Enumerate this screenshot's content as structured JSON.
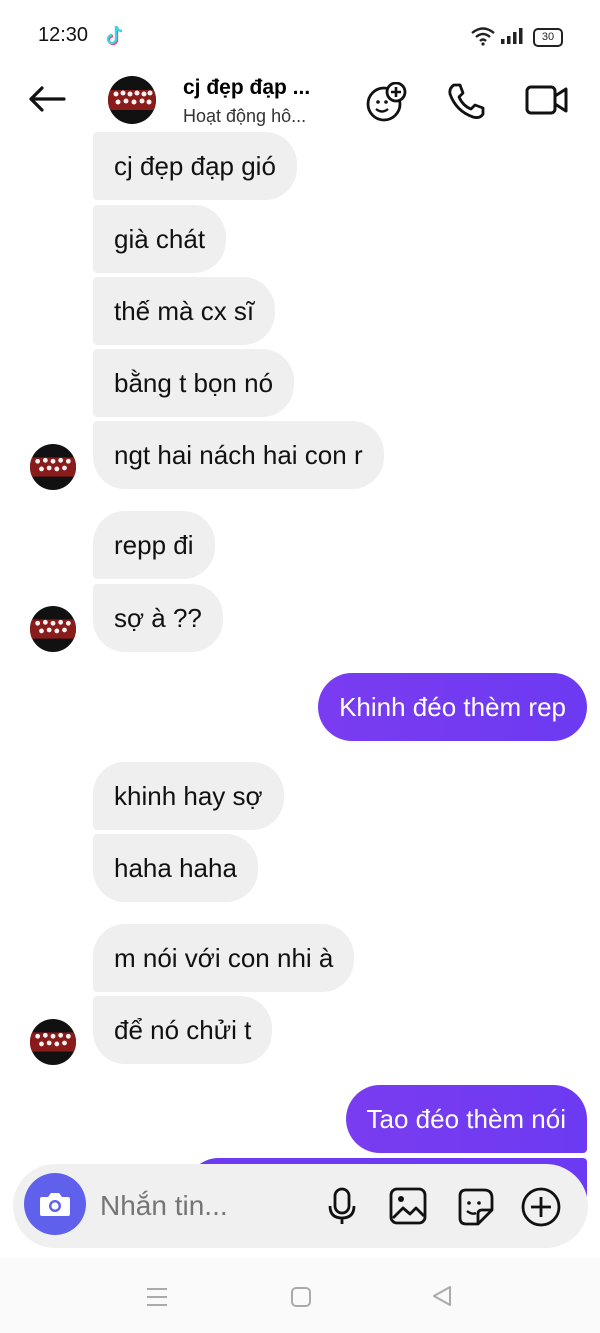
{
  "status_bar": {
    "time": "12:30",
    "battery": "30"
  },
  "header": {
    "contact_name": "cj đẹp đạp ...",
    "contact_status": "Hoạt động hô..."
  },
  "messages": [
    {
      "side": "in",
      "text": "cj đẹp đạp gió"
    },
    {
      "side": "in",
      "text": "già chát"
    },
    {
      "side": "in",
      "text": "thế mà cx sĩ"
    },
    {
      "side": "in",
      "text": "bằng t bọn nó"
    },
    {
      "side": "in",
      "text": "ngt hai nách hai con r"
    },
    {
      "side": "in",
      "text": "repp đi"
    },
    {
      "side": "in",
      "text": "sợ à ??"
    },
    {
      "side": "out",
      "text": "Khinh đéo thèm rep"
    },
    {
      "side": "in",
      "text": "khinh hay sợ"
    },
    {
      "side": "in",
      "text": "haha haha"
    },
    {
      "side": "in",
      "text": "m nói với con nhi à"
    },
    {
      "side": "in",
      "text": "để nó chửi t"
    },
    {
      "side": "out",
      "text": "Tao đéo thèm nói"
    }
  ],
  "composer": {
    "placeholder": "Nhắn tin..."
  },
  "colors": {
    "accent": "#7a3cf0",
    "camera": "#5f61ec",
    "bubble_in": "#efefef"
  }
}
